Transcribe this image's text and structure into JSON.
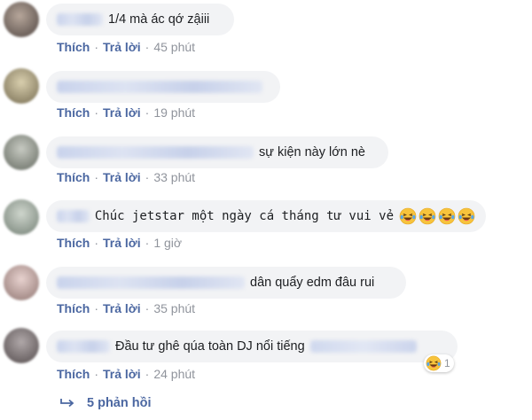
{
  "comments": [
    {
      "avatar_color": "#8a7b72",
      "text": "1/4 mà ác qớ zậiii",
      "like": "Thích",
      "reply": "Trả lời",
      "time": "45 phút"
    },
    {
      "avatar_color": "#b8ab8c",
      "text": "",
      "like": "Thích",
      "reply": "Trả lời",
      "time": "19 phút"
    },
    {
      "avatar_color": "#9fa49b",
      "text": "sự kiện này lớn nè",
      "like": "Thích",
      "reply": "Trả lời",
      "time": "33 phút"
    },
    {
      "avatar_color": "#a9b3aa",
      "text": "Chúc jetstar một ngày cá tháng tư vui vẻ",
      "emoji": "laughing-crying-emoji",
      "emoji_count_inline": 4,
      "like": "Thích",
      "reply": "Trả lời",
      "time": "1 giờ"
    },
    {
      "avatar_color": "#d3b7b4",
      "text": "dân quẩy edm đâu rui",
      "like": "Thích",
      "reply": "Trả lời",
      "time": "35 phút"
    },
    {
      "avatar_color": "#8c8586",
      "text": "Đầu tư ghê qúa toàn DJ nổi tiếng",
      "like": "Thích",
      "reply": "Trả lời",
      "time": "24 phút",
      "reaction": {
        "icon": "haha-reaction-icon",
        "count": "1"
      }
    }
  ],
  "replies": {
    "label": "5 phản hồi",
    "icon": "reply-arrow-icon"
  },
  "colors": {
    "link": "#4b67a1",
    "muted": "#90949c",
    "bubble": "#f2f3f5"
  }
}
